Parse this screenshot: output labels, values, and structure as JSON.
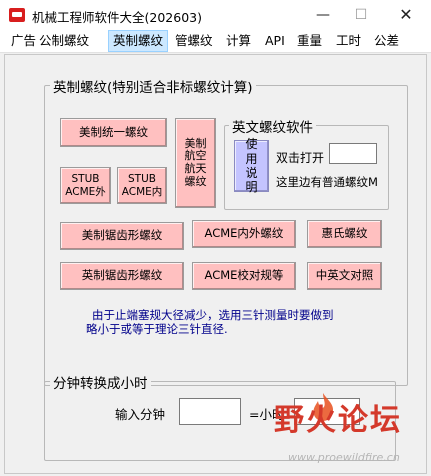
{
  "window": {
    "title": "机械工程师软件大全(202603)",
    "minimize_glyph": "—",
    "maximize_glyph": "☐",
    "close_glyph": "✕"
  },
  "menu": {
    "items": [
      "广告",
      "公制螺纹",
      "英制螺纹",
      "管螺纹",
      "计算",
      "API",
      "重量",
      "工时",
      "公差"
    ],
    "active": "英制螺纹"
  },
  "imperial_group": {
    "title": "英制螺纹(特别适合非标螺纹计算)",
    "buttons": {
      "unified": "美制统一螺纹",
      "aerospace": "美制\n航空\n航天\n螺纹",
      "stub_ext": "STUB\nACME外",
      "stub_int": "STUB\nACME内",
      "us_buttress": "美制锯齿形螺纹",
      "acme_inout": "ACME内外螺纹",
      "whitworth": "惠氏螺纹",
      "uk_buttress": "英制锯齿形螺纹",
      "acme_check": "ACME校对规等",
      "zh_en_table": "中英文对照"
    },
    "software_group": {
      "title": "英文螺纹软件",
      "use_button": "使用\n说明",
      "double_click_label": "双击打开",
      "input_value": "",
      "note": "这里边有普通螺纹M"
    },
    "footnote_lines": [
      "由于止端塞规大径减少，选用三针测量时要做到",
      "略小于或等于理论三针直径."
    ]
  },
  "time_group": {
    "title": "分钟转换成小时",
    "minutes_label": "输入分钟",
    "minutes_value": "",
    "hours_label": "=小时",
    "hours_value": ""
  },
  "watermark": {
    "text": "野火论坛",
    "url": "www.proewildfire.cn"
  },
  "colors": {
    "button_pink": "#ffc0c0",
    "button_lavender": "#c4c4ff",
    "note_text": "#00008b",
    "active_menu": "#cce8ff",
    "watermark_red": "#d4392b"
  }
}
